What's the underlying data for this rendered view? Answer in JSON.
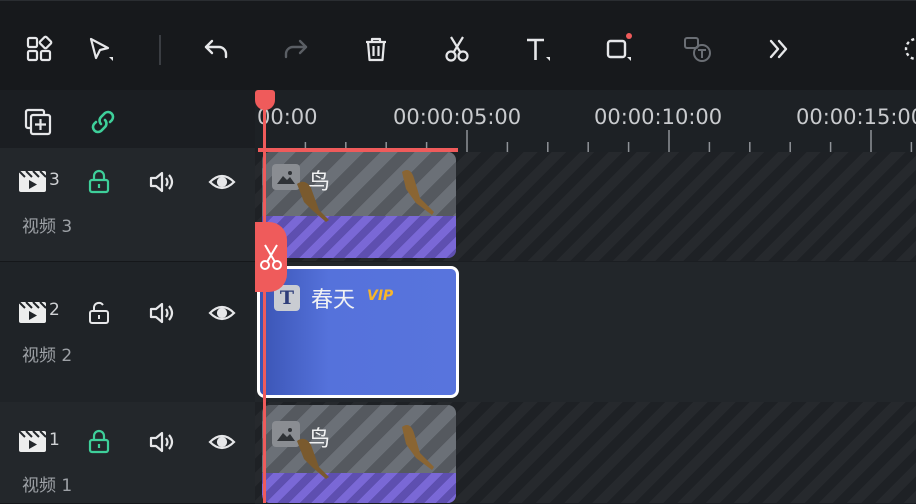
{
  "ruler": {
    "ticks": [
      "00:00",
      "00:00:05:00",
      "00:00:10:00",
      "00:00:15:00"
    ]
  },
  "tracks": [
    {
      "number": "3",
      "label": "视频 3",
      "locked": true
    },
    {
      "number": "2",
      "label": "视频 2",
      "locked": false
    },
    {
      "number": "1",
      "label": "视频 1",
      "locked": true
    }
  ],
  "clips": {
    "track3_name": "鸟",
    "track2_name": "春天",
    "track2_badge": "VIP",
    "track1_name": "鸟"
  },
  "colors": {
    "accent_green": "#3ecf9a",
    "playhead_red": "#ef5b5b",
    "vip_gold": "#f7b52b",
    "title_clip_blue": "#5874dd"
  },
  "icons": {
    "toolbar": [
      "layout-icon",
      "select-tool-icon",
      "undo-icon",
      "redo-icon",
      "delete-icon",
      "scissors-icon",
      "text-icon",
      "shape-icon",
      "text-to-speech-icon",
      "more-icon",
      "settings-gear-icon"
    ],
    "header": [
      "add-track-icon",
      "link-icon"
    ]
  }
}
